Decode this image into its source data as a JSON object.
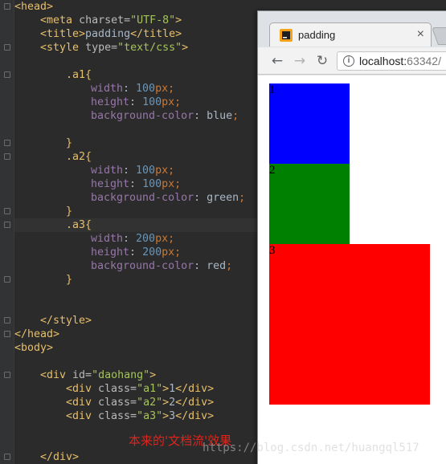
{
  "code": {
    "head_open": "<head>",
    "meta_tag": "meta",
    "meta_attr": "charset",
    "meta_value": "\"UTF-8\"",
    "title_open": "<title>",
    "title_text": "padding",
    "title_close": "</title>",
    "style_tag": "style",
    "style_attr": "type",
    "style_value": "\"text/css\"",
    "rules": [
      {
        "selector": ".a1{",
        "width": "100",
        "height": "100",
        "bg": "blue"
      },
      {
        "selector": ".a2{",
        "width": "100",
        "height": "100",
        "bg": "green"
      },
      {
        "selector": ".a3{",
        "width": "200",
        "height": "200",
        "bg": "red"
      }
    ],
    "prop_width": "width",
    "prop_height": "height",
    "prop_bg": "background-color",
    "unit": "px",
    "close_brace": "}",
    "style_close": "</style>",
    "head_close": "</head>",
    "body_open": "<body>",
    "div_id_value": "\"daohang\"",
    "divs": [
      {
        "cls": "\"a1\"",
        "text": "1"
      },
      {
        "cls": "\"a2\"",
        "text": "2"
      },
      {
        "cls": "\"a3\"",
        "text": "3"
      }
    ],
    "div_close": "</div>"
  },
  "browser": {
    "tab_title": "padding",
    "tab_close": "×",
    "url": "localhost:",
    "url_port": "63342/",
    "back": "←",
    "forward": "→",
    "reload": "↻",
    "boxes": [
      {
        "label": "1",
        "color": "#0000ff"
      },
      {
        "label": "2",
        "color": "#008000"
      },
      {
        "label": "3",
        "color": "#ff0000"
      }
    ]
  },
  "annotation": "本来的'文档流'效果",
  "watermark": "https://blog.csdn.net/huangql517"
}
